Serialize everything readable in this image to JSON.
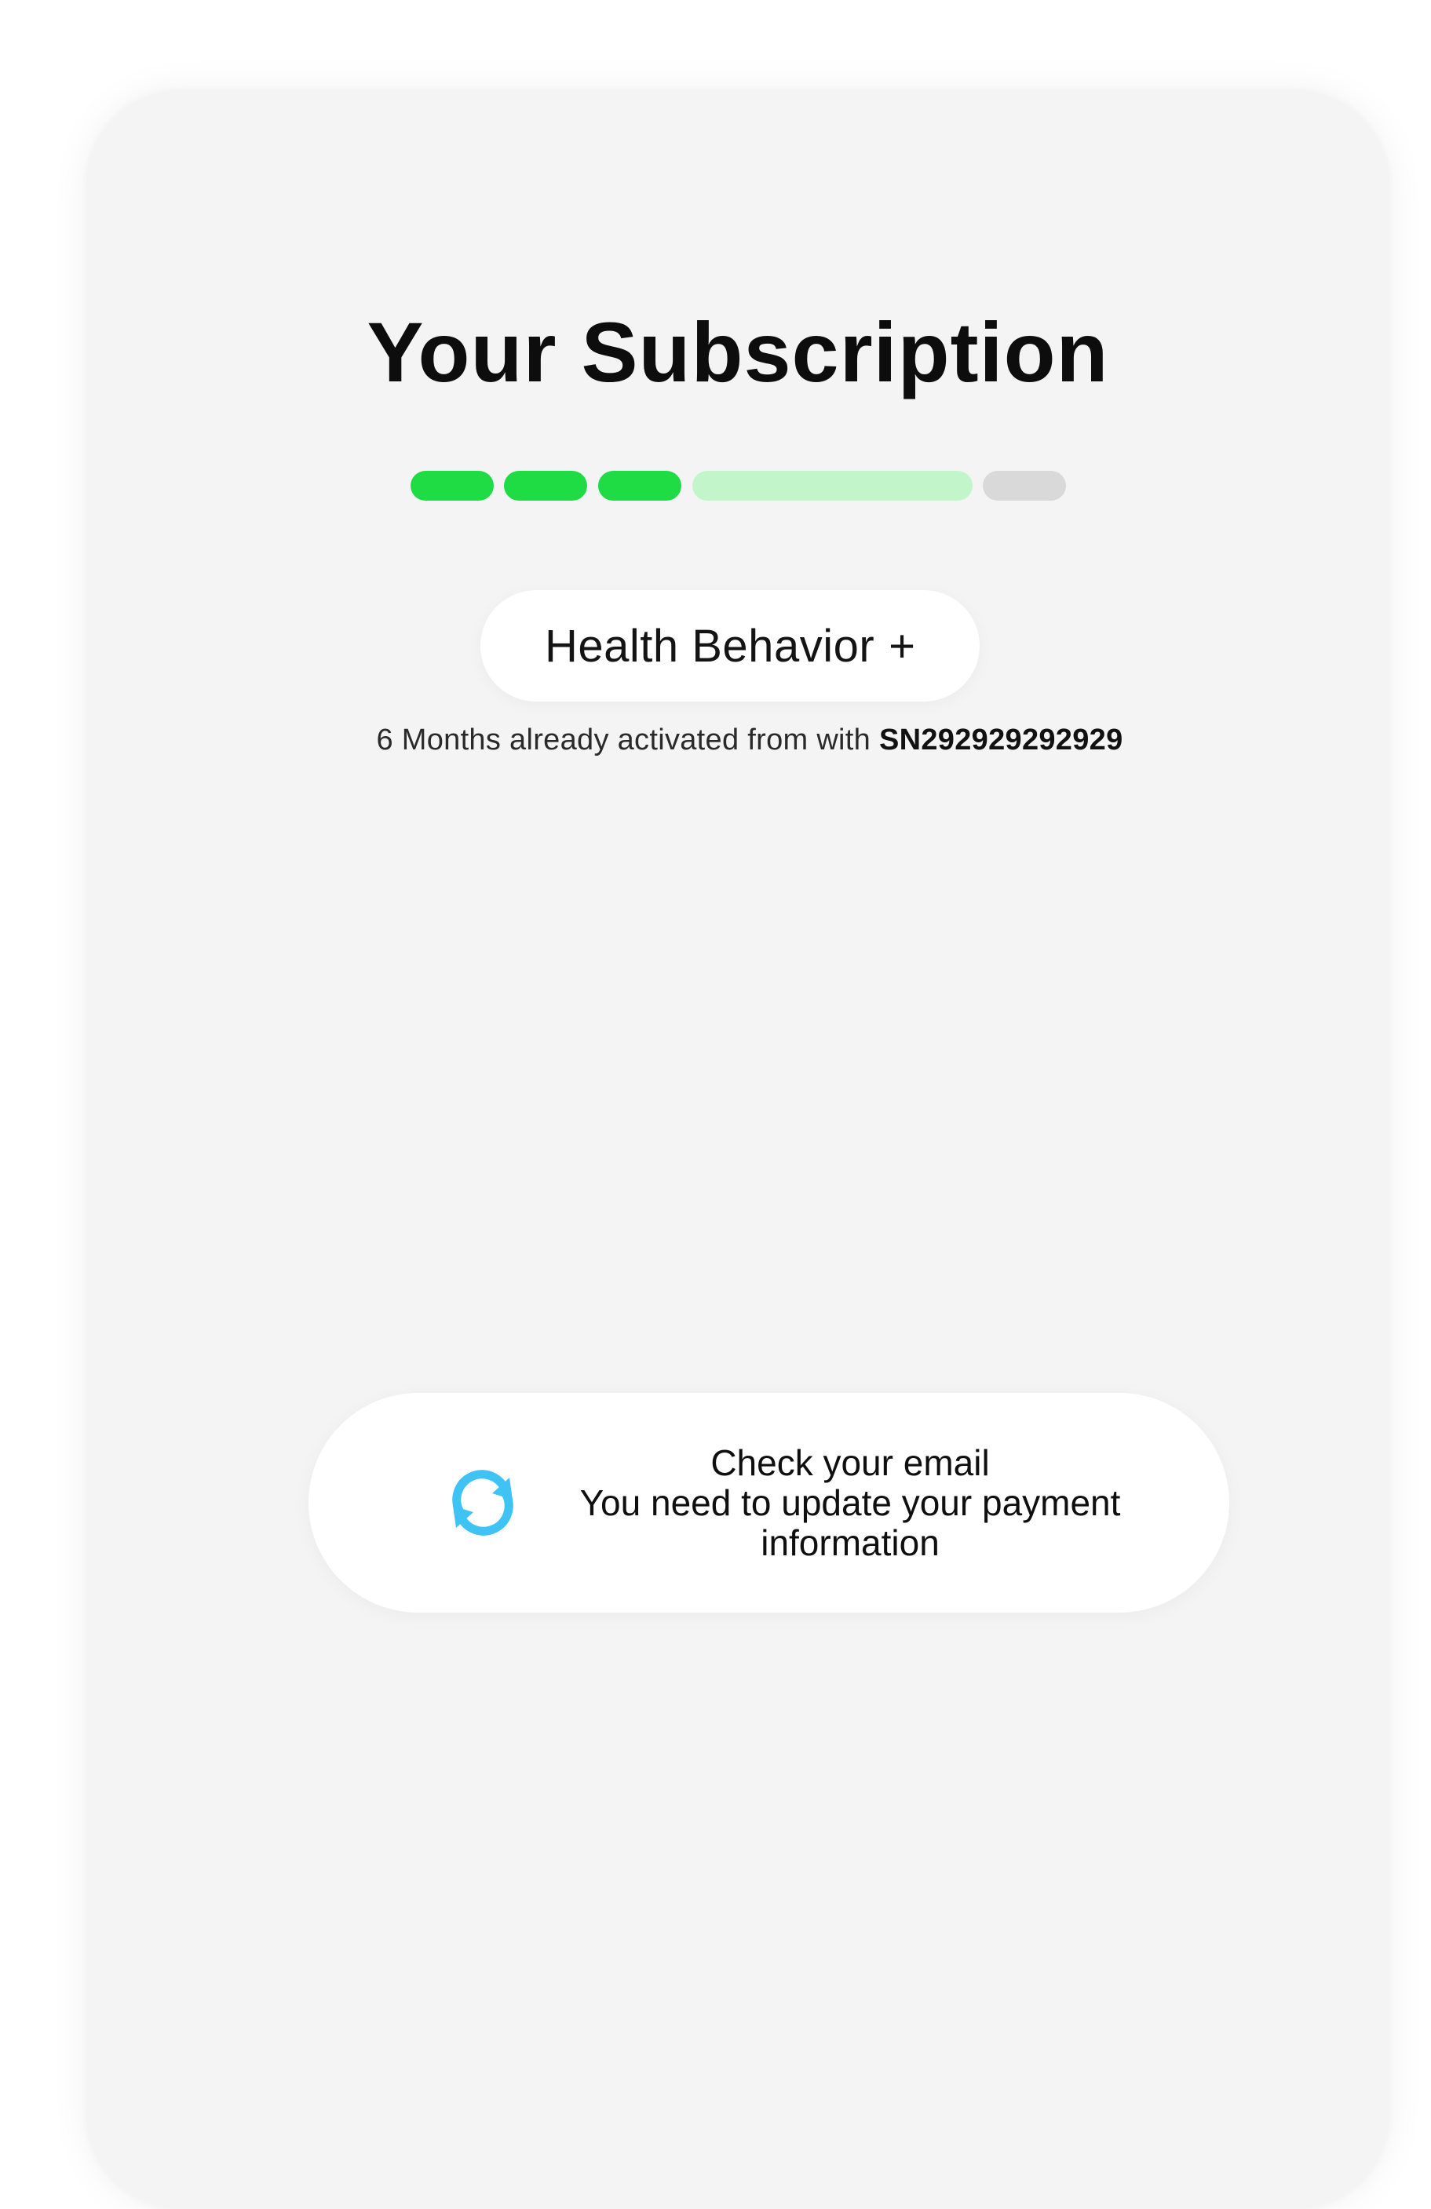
{
  "page": {
    "title": "Your Subscription"
  },
  "progress": {
    "segments": [
      {
        "state": "complete",
        "color": "#1fdc45"
      },
      {
        "state": "complete",
        "color": "#1fdc45"
      },
      {
        "state": "complete",
        "color": "#1fdc45"
      },
      {
        "state": "current",
        "color": "#c3f5cb"
      },
      {
        "state": "pending",
        "color": "#d9d9d9"
      }
    ]
  },
  "plan": {
    "name": "Health Behavior",
    "plus_symbol": "+"
  },
  "activation": {
    "text": "6 Months already activated from with ",
    "serial": "SN292929292929"
  },
  "notice": {
    "icon": "refresh-icon",
    "icon_color": "#3fc3f5",
    "title": "Check your email",
    "line2": "You need to update your payment",
    "line3": "information"
  }
}
